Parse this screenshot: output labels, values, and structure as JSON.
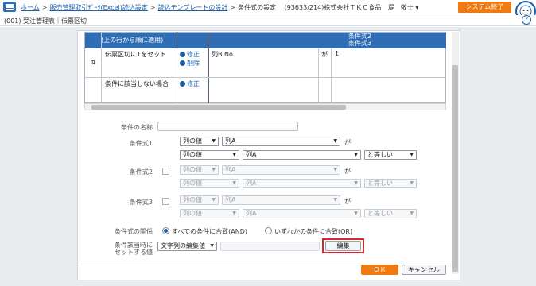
{
  "header": {
    "breadcrumbs": [
      "ホーム",
      "販売管理取引ﾃﾞｰﾀ(Excel)読込設定",
      "読込テンプレートの設計"
    ],
    "current": "条件式の設定",
    "company": "(93633/214)株式会社ＴＫＣ食品",
    "user": "堤　敬士 ▾",
    "logout": "システム終了"
  },
  "subheader": {
    "title": "(001) 受注管理表｜伝票区切"
  },
  "table": {
    "header_left": "(上の行から順に適用)",
    "header_right_1": "条件式2",
    "header_right_2": "条件式3",
    "rows": [
      {
        "handle": "⇅",
        "label": "伝票区切に1をセット",
        "edit": "修正",
        "delete": "削除",
        "value1": "列B No.",
        "op": "が",
        "value2": "1"
      },
      {
        "label": "条件に該当しない場合",
        "edit": "修正"
      }
    ]
  },
  "form": {
    "name_label": "条件の名称",
    "name_value": "",
    "cond1_label": "条件式1",
    "cond2_label": "条件式2",
    "cond3_label": "条件式3",
    "opt_col_value": "列の値",
    "opt_colA": "列A",
    "ga": "が",
    "eq": "と等しい",
    "relation_label": "条件式の関係",
    "relation_and": "すべての条件に合致(AND)",
    "relation_or": "いずれかの条件に合致(OR)",
    "set_label_1": "条件該当時に",
    "set_label_2": "セットする値",
    "set_type": "文字列の編集値",
    "edit_button": "編集"
  },
  "footer": {
    "ok": "ＯＫ",
    "cancel": "キャンセル"
  }
}
